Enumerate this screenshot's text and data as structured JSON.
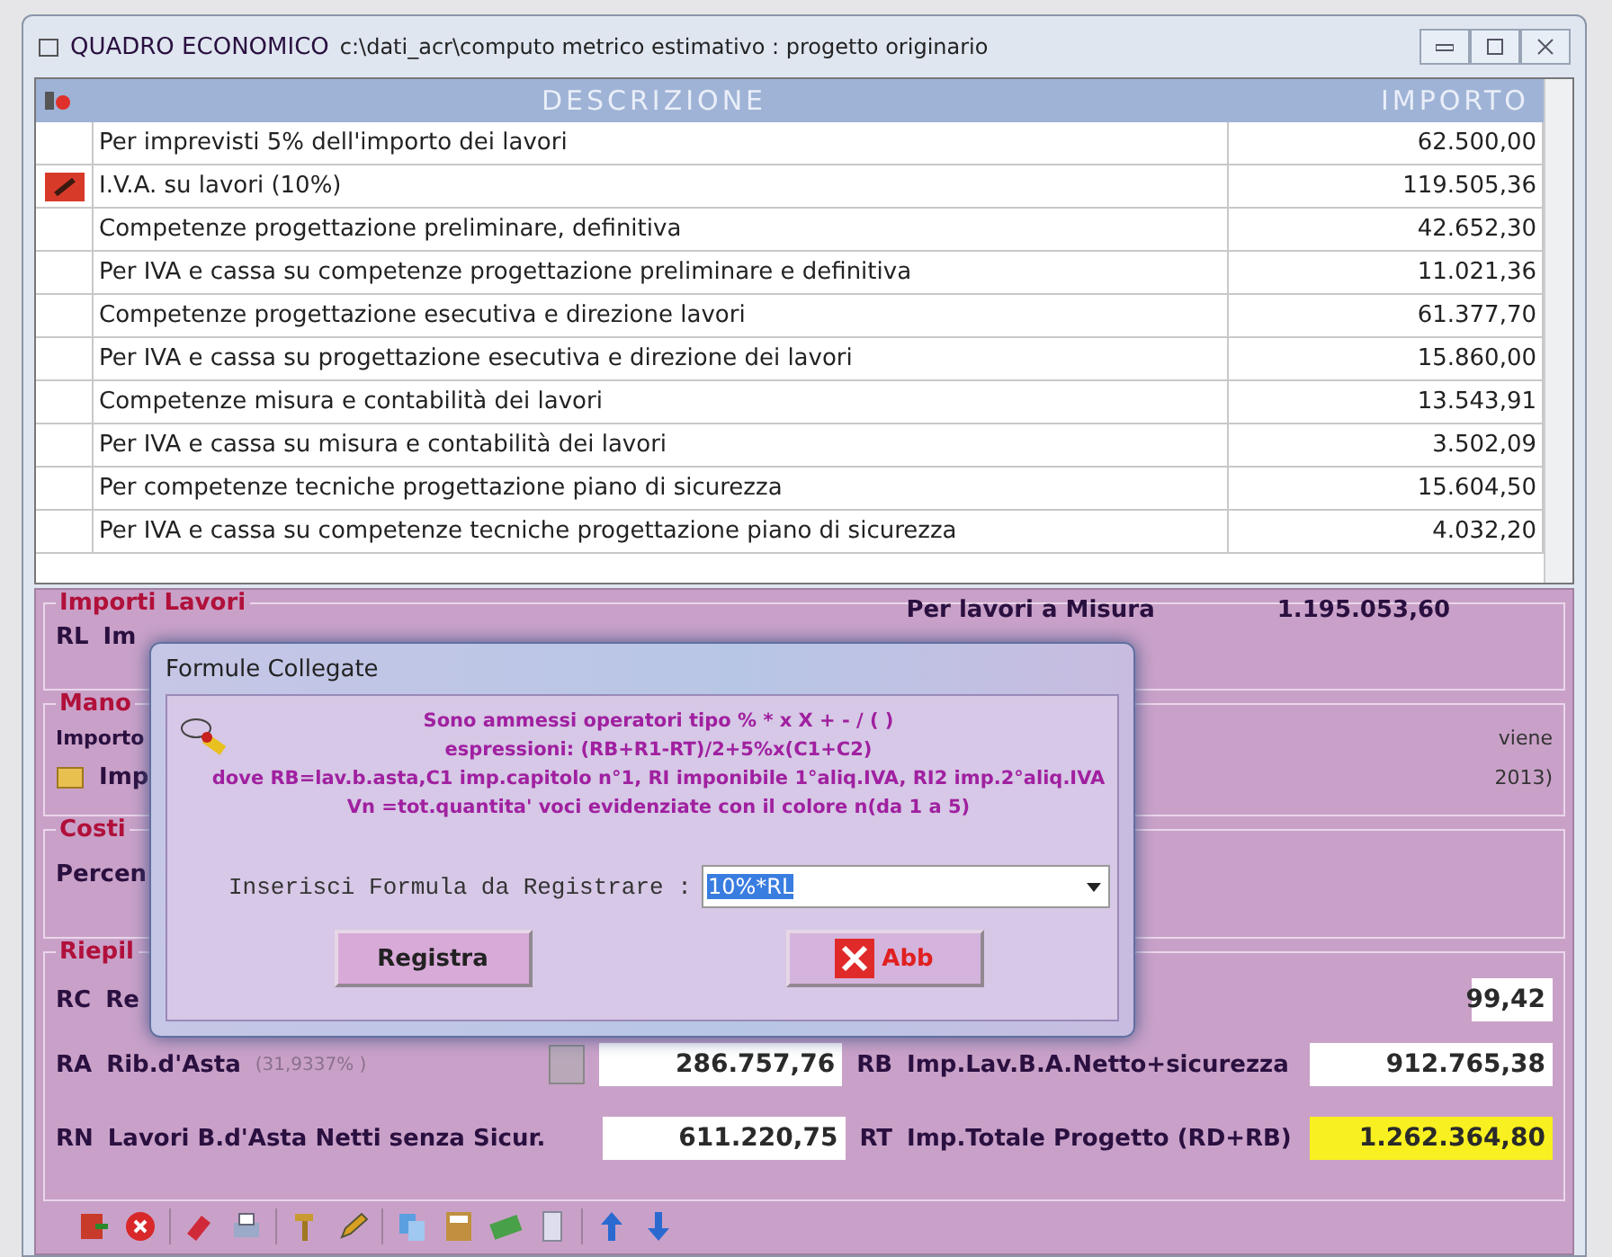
{
  "window": {
    "title": "QUADRO ECONOMICO",
    "path": "c:\\dati_acr\\computo metrico estimativo : progetto originario"
  },
  "table": {
    "columns": [
      "DESCRIZIONE",
      "IMPORTO"
    ],
    "rows": [
      {
        "descrizione": "Per imprevisti 5% dell'importo dei lavori",
        "importo": "62.500,00",
        "selected": false
      },
      {
        "descrizione": "I.V.A. su lavori (10%)",
        "importo": "119.505,36",
        "selected": true
      },
      {
        "descrizione": "Competenze progettazione preliminare, definitiva",
        "importo": "42.652,30",
        "selected": false
      },
      {
        "descrizione": "Per IVA e cassa su competenze progettazione preliminare e definitiva",
        "importo": "11.021,36",
        "selected": false
      },
      {
        "descrizione": "Competenze progettazione esecutiva e direzione lavori",
        "importo": "61.377,70",
        "selected": false
      },
      {
        "descrizione": "Per IVA e cassa su progettazione esecutiva e direzione dei lavori",
        "importo": "15.860,00",
        "selected": false
      },
      {
        "descrizione": "Competenze misura e contabilità dei lavori",
        "importo": "13.543,91",
        "selected": false
      },
      {
        "descrizione": "Per IVA e cassa su misura e contabilità dei lavori",
        "importo": "3.502,09",
        "selected": false
      },
      {
        "descrizione": "Per competenze tecniche progettazione piano di sicurezza",
        "importo": "15.604,50",
        "selected": false
      },
      {
        "descrizione": "Per IVA e cassa su competenze tecniche progettazione piano di sicurezza",
        "importo": "4.032,20",
        "selected": false
      }
    ]
  },
  "importi_lavori": {
    "legend": "Importi Lavori",
    "code": "RL",
    "label": "Im",
    "misura_label": "Per lavori a Misura",
    "misura_value": "1.195.053,60"
  },
  "manodopera": {
    "legend": "Mano",
    "label": "Importo",
    "sub_label": "Imp",
    "note_1": "viene",
    "note_2": "2013)"
  },
  "costi": {
    "legend": "Costi",
    "label": "Percen"
  },
  "riepilogo": {
    "legend": "Riepil",
    "rc": {
      "code": "RC",
      "label": "Re",
      "value": "99,42"
    },
    "ra": {
      "code": "RA",
      "label": "Rib.d'Asta",
      "percent": "(31,9337% )",
      "value": "286.757,76"
    },
    "rb": {
      "code": "RB",
      "label": "Imp.Lav.B.A.Netto+sicurezza",
      "value": "912.765,38"
    },
    "rn": {
      "code": "RN",
      "label": "Lavori B.d'Asta Netti senza Sicur.",
      "value": "611.220,75"
    },
    "rt": {
      "code": "RT",
      "label": "Imp.Totale Progetto (RD+RB)",
      "value": "1.262.364,80"
    }
  },
  "dialog": {
    "title": "Formule Collegate",
    "help_lines": [
      "Sono ammessi operatori tipo % * x X + - / ( )",
      "espressioni: (RB+R1-RT)/2+5%x(C1+C2)",
      "dove RB=lav.b.asta,C1 imp.capitolo n°1, RI imponibile 1°aliq.IVA, RI2 imp.2°aliq.IVA",
      "Vn =tot.quantita' voci evidenziate con il colore n(da 1 a 5)"
    ],
    "input_label": "Inserisci Formula da Registrare :",
    "input_value": "10%*RL",
    "buttons": [
      {
        "label": "Registra",
        "kind": "save"
      },
      {
        "label": "Abb",
        "kind": "cancel"
      }
    ]
  }
}
